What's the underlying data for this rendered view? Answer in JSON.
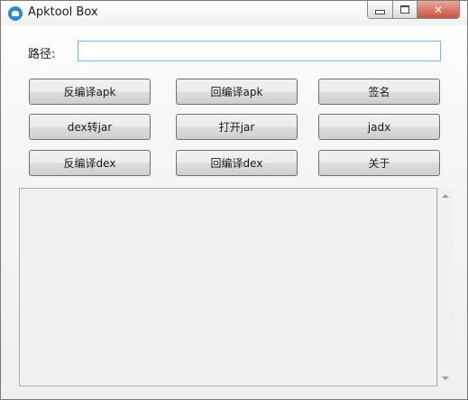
{
  "window": {
    "title": "Apktool Box",
    "close_glyph": "✕"
  },
  "path": {
    "label": "路径:",
    "value": ""
  },
  "buttons": {
    "decompile_apk": "反编译apk",
    "recompile_apk": "回编译apk",
    "sign": "签名",
    "dex_to_jar": "dex转jar",
    "open_jar": "打开jar",
    "jadx": "jadx",
    "decompile_dex": "反编译dex",
    "recompile_dex": "回编译dex",
    "about": "关于"
  },
  "output": {
    "text": ""
  },
  "icons": {
    "app": "android-app-icon",
    "minimize": "minimize-icon",
    "maximize": "maximize-icon",
    "close": "close-icon"
  },
  "colors": {
    "input_border": "#7eb4ea",
    "close_button": "#c8523d",
    "app_icon": "#2b8bd6"
  }
}
